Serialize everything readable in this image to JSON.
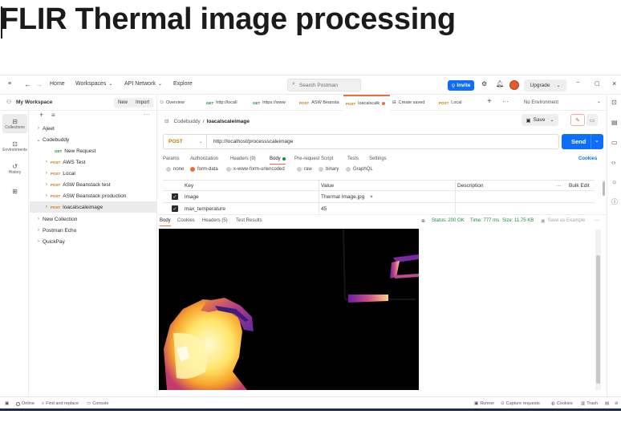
{
  "page_title": "FLIR Thermal image processing",
  "topbar": {
    "home": "Home",
    "workspaces": "Workspaces",
    "api_network": "API Network",
    "explore": "Explore",
    "search_placeholder": "Search Postman",
    "invite": "Invite",
    "upgrade": "Upgrade"
  },
  "workspace": {
    "name": "My Workspace",
    "new_label": "New",
    "import_label": "Import"
  },
  "rail": [
    {
      "icon": "collections-icon",
      "label": "Collections"
    },
    {
      "icon": "environments-icon",
      "label": "Environments"
    },
    {
      "icon": "history-icon",
      "label": "History"
    },
    {
      "icon": "apps-icon",
      "label": ""
    }
  ],
  "sidebar": {
    "items": [
      {
        "label": "Ajeet",
        "method": "",
        "level": 0
      },
      {
        "label": "Codebuddy",
        "method": "",
        "level": 0
      },
      {
        "label": "New Request",
        "method": "GET",
        "level": 2
      },
      {
        "label": "AWS Test",
        "method": "POST",
        "level": 1
      },
      {
        "label": "Local",
        "method": "POST",
        "level": 1
      },
      {
        "label": "ASW Beanstack test",
        "method": "POST",
        "level": 1
      },
      {
        "label": "ASW Beanstack production",
        "method": "POST",
        "level": 1
      },
      {
        "label": "loacalscaleimage",
        "method": "POST",
        "level": 1
      },
      {
        "label": "New Collection",
        "method": "",
        "level": 0
      },
      {
        "label": "Postman Echo",
        "method": "",
        "level": 0
      },
      {
        "label": "QuickPay",
        "method": "",
        "level": 0
      }
    ]
  },
  "tabs": [
    {
      "label": "Overview",
      "method": ""
    },
    {
      "label": "http://locall",
      "method": "GET"
    },
    {
      "label": "https://www",
      "method": "GET"
    },
    {
      "label": "ASW Beansta",
      "method": "POST"
    },
    {
      "label": "loacalscalk",
      "method": "POST"
    },
    {
      "label": "Create saved",
      "method": ""
    },
    {
      "label": "Local",
      "method": "POST"
    }
  ],
  "environment": "No Environment",
  "request": {
    "breadcrumb_parent": "Codebuddy",
    "breadcrumb_sep": "/",
    "breadcrumb_current": "loacalscaleimage",
    "save": "Save",
    "method": "POST",
    "url": "http://localhost/processscaleimage",
    "send": "Send",
    "tabs": {
      "params": "Params",
      "authorization": "Authorization",
      "headers": "Headers (9)",
      "body": "Body",
      "prerequest": "Pre-request Script",
      "tests": "Tests",
      "settings": "Settings",
      "cookies": "Cookies"
    },
    "body_options": [
      "none",
      "form-data",
      "x-www-form-urlencoded",
      "raw",
      "binary",
      "GraphQL"
    ],
    "table": {
      "col_key": "Key",
      "col_value": "Value",
      "col_description": "Description",
      "bulk_edit": "Bulk Edit",
      "more": "···",
      "rows": [
        {
          "key": "image",
          "value": "Thermal Image.jpg",
          "remove": "×"
        },
        {
          "key": "max_temperature",
          "value": "45",
          "remove": ""
        }
      ]
    }
  },
  "response": {
    "tabs": {
      "body": "Body",
      "cookies": "Cookies",
      "headers": "Headers (5)",
      "test_results": "Test Results"
    },
    "status": "Status: 200 OK",
    "time": "Time: 777 ms",
    "size": "Size: 11.75 KB",
    "save_example": "Save as Example",
    "more": "···"
  },
  "footer": {
    "online": "Online",
    "find_replace": "Find and replace",
    "console": "Console",
    "runner": "Runner",
    "capture": "Capture requests",
    "cookies": "Cookies",
    "trash": "Trash"
  },
  "colors": {
    "accent_orange": "#f26b3a",
    "send_blue": "#0d6efd",
    "post_method": "#c87a00",
    "get_method": "#1c8c3b"
  }
}
